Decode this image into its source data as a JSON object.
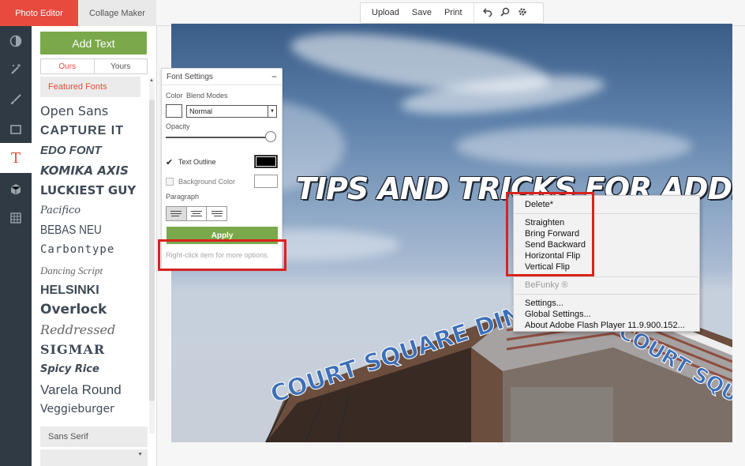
{
  "top_tabs": {
    "photo_editor": "Photo Editor",
    "collage_maker": "Collage Maker"
  },
  "toolbar": {
    "upload": "Upload",
    "save": "Save",
    "print": "Print",
    "undo_icon": "undo-icon",
    "search_icon": "zoom-icon",
    "settings_icon": "gear-icon"
  },
  "rail": {
    "icons": [
      "adjust-icon",
      "magic-wand-icon",
      "brush-icon",
      "frame-icon",
      "text-icon",
      "cube-icon",
      "texture-icon"
    ],
    "active": "text-icon",
    "text_glyph": "T"
  },
  "font_panel": {
    "add_text": "Add Text",
    "tabs": [
      "Ours",
      "Yours"
    ],
    "featured_label": "Featured Fonts",
    "fonts": [
      "Open Sans",
      "CAPTURE IT",
      "EDO FONT",
      "KOMIKA AXIS",
      "LUCKIEST GUY",
      "Pacifico",
      "BEBAS NEU",
      "Carbontype",
      "Dancing Script",
      "HELSINKI",
      "Overlock",
      "Reddressed",
      "SIGMAR",
      "Spicy Rice",
      "Varela Round",
      "Veggieburger"
    ],
    "category_label": "Sans Serif"
  },
  "canvas": {
    "headline": "TIPS AND TRICKS FOR ADDING TEXT!",
    "sign_left": "COURT SQUARE DINER",
    "sign_right": "COURT SQUARE"
  },
  "font_settings": {
    "title": "Font Settings",
    "minimize": "−",
    "color_label": "Color",
    "blend_label": "Blend Modes",
    "blend_value": "Normal",
    "opacity_label": "Opacity",
    "opacity_value": 1.0,
    "text_outline_label": "Text Outline",
    "text_outline_checked": true,
    "text_outline_color": "#000000",
    "background_color_label": "Background Color",
    "background_color_checked": false,
    "paragraph_label": "Paragraph",
    "alignment_active": "left",
    "apply": "Apply",
    "hint": "Right-click item for more options."
  },
  "context_menu": {
    "delete": "Delete*",
    "items": [
      "Straighten",
      "Bring Forward",
      "Send Backward",
      "Horizontal Flip",
      "Vertical Flip"
    ],
    "brand": "BeFunky ®",
    "settings": "Settings...",
    "global_settings": "Global Settings...",
    "about": "About Adobe Flash Player 11.9.900.152..."
  },
  "colors": {
    "accent_red": "#e84a3e",
    "button_green": "#7aa84b",
    "rail_dark": "#2f3a44",
    "annotation_red": "#d8231e"
  }
}
